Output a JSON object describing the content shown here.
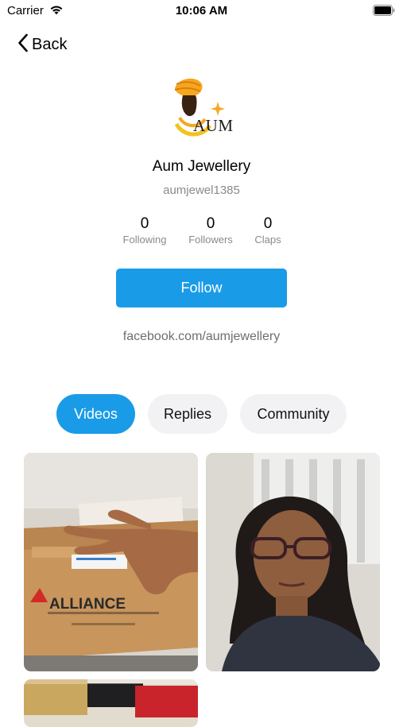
{
  "status_bar": {
    "carrier": "Carrier",
    "time": "10:06 AM",
    "icons": [
      "wifi-icon",
      "battery-icon"
    ]
  },
  "nav": {
    "back_label": "Back",
    "back_icon": "chevron-left-icon"
  },
  "profile": {
    "logo_text": "AUM",
    "name": "Aum Jewellery",
    "handle": "aumjewel1385",
    "stats": [
      {
        "value": "0",
        "label": "Following"
      },
      {
        "value": "0",
        "label": "Followers"
      },
      {
        "value": "0",
        "label": "Claps"
      }
    ],
    "follow_label": "Follow",
    "link": "facebook.com/aumjewellery"
  },
  "tabs": [
    {
      "label": "Videos",
      "active": true
    },
    {
      "label": "Replies",
      "active": false
    },
    {
      "label": "Community",
      "active": false
    }
  ],
  "videos": [
    {
      "description": "hand on cardboard box",
      "overlay_text": "ALLIANCE"
    },
    {
      "description": "woman with glasses"
    },
    {
      "description": "partially visible thumbnail"
    }
  ],
  "colors": {
    "accent": "#1a9be8",
    "secondary_text": "#8a8a8e",
    "tab_inactive_bg": "#f2f2f4"
  }
}
